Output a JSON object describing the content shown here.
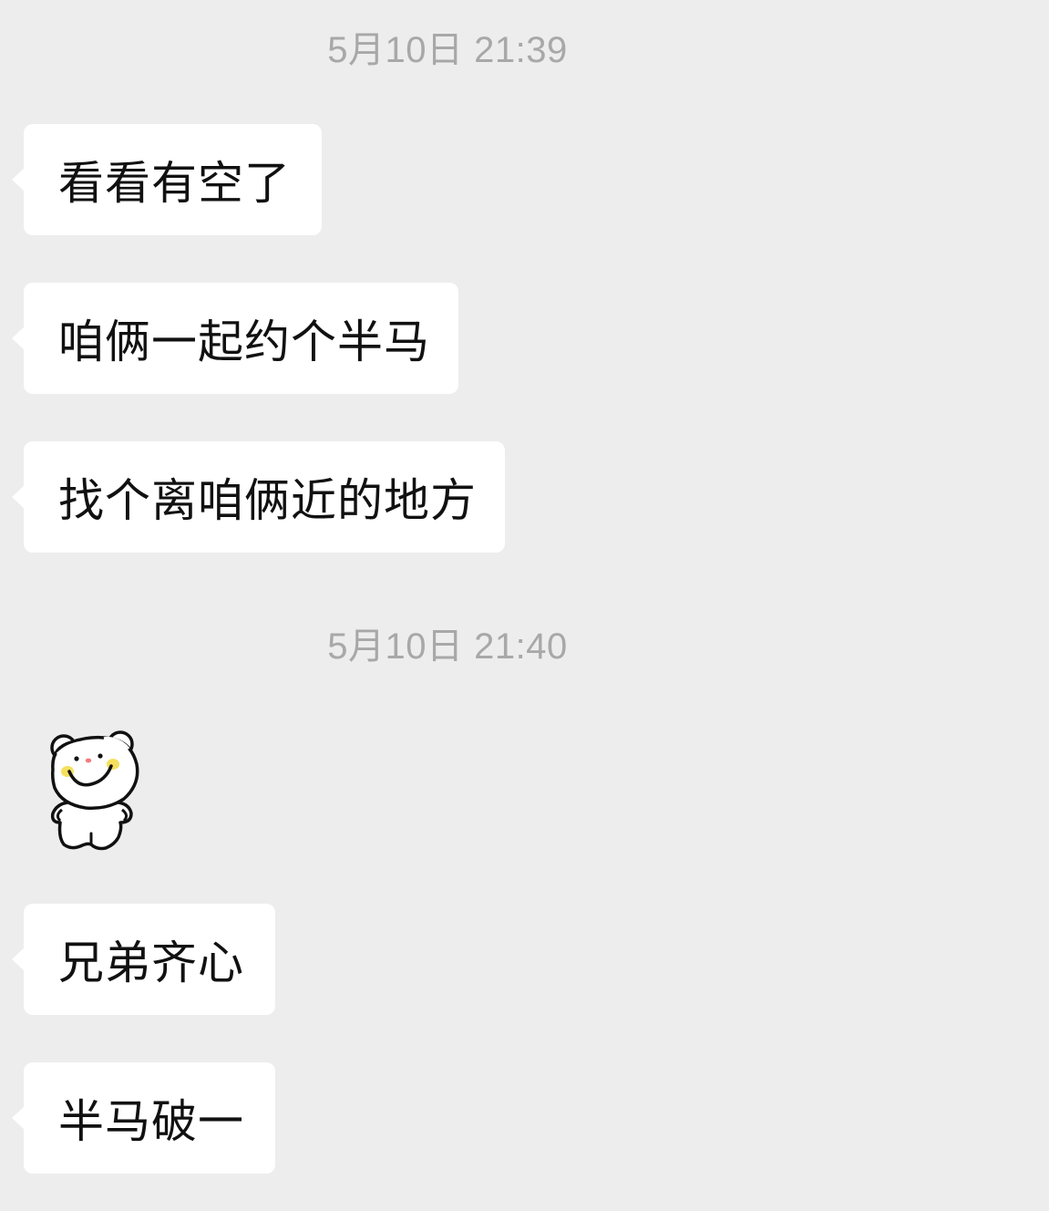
{
  "conversation": {
    "timestamps": [
      "5月10日 21:39",
      "5月10日 21:40"
    ],
    "messages": [
      {
        "type": "text",
        "text": "看看有空了"
      },
      {
        "type": "text",
        "text": "咱俩一起约个半马"
      },
      {
        "type": "text",
        "text": "找个离咱俩近的地方"
      },
      {
        "type": "sticker",
        "icon": "white-bear-sticker-icon"
      },
      {
        "type": "text",
        "text": "兄弟齐心"
      },
      {
        "type": "text",
        "text": "半马破一"
      }
    ]
  },
  "colors": {
    "background": "#ededed",
    "bubble": "#ffffff",
    "timestamp_text": "#a8a8a8",
    "message_text": "#111111",
    "sticker_cheek": "#f5e05c",
    "sticker_nose": "#f27a7a"
  }
}
